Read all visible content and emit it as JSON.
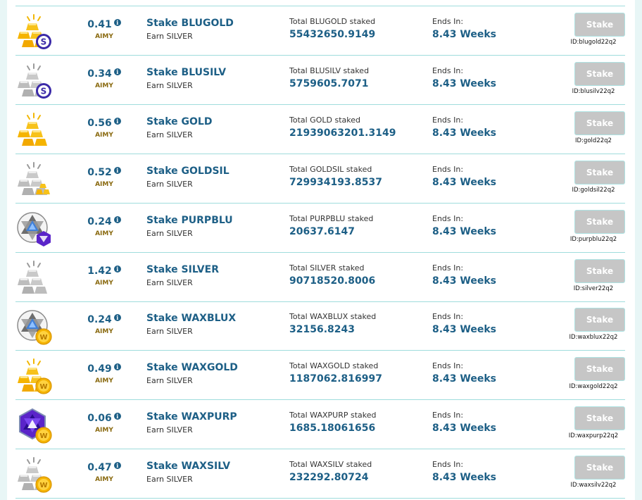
{
  "rows": [
    {
      "apr": "0.41",
      "unit": "AIMY",
      "name": "Stake BLUGOLD",
      "earn": "Earn SILVER",
      "total_label": "Total BLUGOLD staked",
      "total": "55432650.9149",
      "ends_label": "Ends In:",
      "ends": "8.43 Weeks",
      "button": "Stake",
      "id": "ID:blugold22q2",
      "icon": "gold-bars-icon",
      "badge": "blue-coin-icon"
    },
    {
      "apr": "0.34",
      "unit": "AIMY",
      "name": "Stake BLUSILV",
      "earn": "Earn SILVER",
      "total_label": "Total BLUSILV staked",
      "total": "5759605.7071",
      "ends_label": "Ends In:",
      "ends": "8.43 Weeks",
      "button": "Stake",
      "id": "ID:blusilv22q2",
      "icon": "silver-bars-icon",
      "badge": "blue-coin-icon"
    },
    {
      "apr": "0.56",
      "unit": "AIMY",
      "name": "Stake GOLD",
      "earn": "Earn SILVER",
      "total_label": "Total GOLD staked",
      "total": "21939063201.3149",
      "ends_label": "Ends In:",
      "ends": "8.43 Weeks",
      "button": "Stake",
      "id": "ID:gold22q2",
      "icon": "gold-bars-icon",
      "badge": ""
    },
    {
      "apr": "0.52",
      "unit": "AIMY",
      "name": "Stake GOLDSIL",
      "earn": "Earn SILVER",
      "total_label": "Total GOLDSIL staked",
      "total": "729934193.8537",
      "ends_label": "Ends In:",
      "ends": "8.43 Weeks",
      "button": "Stake",
      "id": "ID:goldsil22q2",
      "icon": "silver-bars-icon",
      "badge": "small-gold-bars-icon"
    },
    {
      "apr": "0.24",
      "unit": "AIMY",
      "name": "Stake PURPBLU",
      "earn": "Earn SILVER",
      "total_label": "Total PURPBLU staked",
      "total": "20637.6147",
      "ends_label": "Ends In:",
      "ends": "8.43 Weeks",
      "button": "Stake",
      "id": "ID:purpblu22q2",
      "icon": "star-gem-icon",
      "badge": "purple-gem-icon"
    },
    {
      "apr": "1.42",
      "unit": "AIMY",
      "name": "Stake SILVER",
      "earn": "Earn SILVER",
      "total_label": "Total SILVER staked",
      "total": "90718520.8006",
      "ends_label": "Ends In:",
      "ends": "8.43 Weeks",
      "button": "Stake",
      "id": "ID:silver22q2",
      "icon": "silver-bars-icon",
      "badge": ""
    },
    {
      "apr": "0.24",
      "unit": "AIMY",
      "name": "Stake WAXBLUX",
      "earn": "Earn SILVER",
      "total_label": "Total WAXBLUX staked",
      "total": "32156.8243",
      "ends_label": "Ends In:",
      "ends": "8.43 Weeks",
      "button": "Stake",
      "id": "ID:waxblux22q2",
      "icon": "star-gem-icon",
      "badge": "wax-coin-icon"
    },
    {
      "apr": "0.49",
      "unit": "AIMY",
      "name": "Stake WAXGOLD",
      "earn": "Earn SILVER",
      "total_label": "Total WAXGOLD staked",
      "total": "1187062.816997",
      "ends_label": "Ends In:",
      "ends": "8.43 Weeks",
      "button": "Stake",
      "id": "ID:waxgold22q2",
      "icon": "gold-bars-icon",
      "badge": "wax-coin-icon"
    },
    {
      "apr": "0.06",
      "unit": "AIMY",
      "name": "Stake WAXPURP",
      "earn": "Earn SILVER",
      "total_label": "Total WAXPURP staked",
      "total": "1685.18061656",
      "ends_label": "Ends In:",
      "ends": "8.43 Weeks",
      "button": "Stake",
      "id": "ID:waxpurp22q2",
      "icon": "purple-gem-icon",
      "badge": "wax-coin-icon"
    },
    {
      "apr": "0.47",
      "unit": "AIMY",
      "name": "Stake WAXSILV",
      "earn": "Earn SILVER",
      "total_label": "Total WAXSILV staked",
      "total": "232292.80724",
      "ends_label": "Ends In:",
      "ends": "8.43 Weeks",
      "button": "Stake",
      "id": "ID:waxsilv22q2",
      "icon": "silver-bars-icon",
      "badge": "wax-coin-icon"
    }
  ],
  "colors": {
    "accent": "#1d5f86",
    "button": "#c6c6c6",
    "divider": "#9fdcdc",
    "background": "#e8f6f6"
  }
}
